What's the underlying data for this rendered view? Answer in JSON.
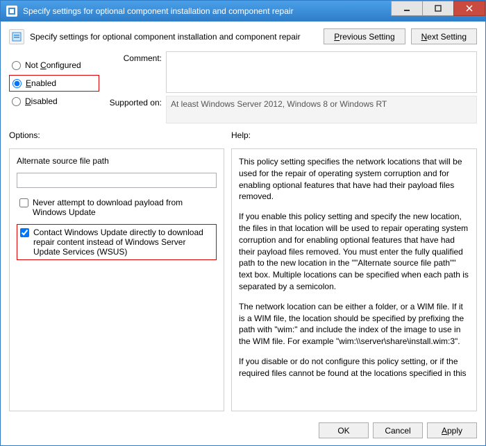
{
  "window": {
    "title": "Specify settings for optional component installation and component repair"
  },
  "header": {
    "text": "Specify settings for optional component installation and component repair",
    "prev_btn": "Previous Setting",
    "next_btn": "Next Setting"
  },
  "radios": {
    "not_configured": "Not Configured",
    "enabled": "Enabled",
    "disabled": "Disabled",
    "selected": "enabled"
  },
  "fields": {
    "comment_label": "Comment:",
    "comment_value": "",
    "supported_label": "Supported on:",
    "supported_value": "At least Windows Server 2012, Windows 8 or Windows RT"
  },
  "labels": {
    "options": "Options:",
    "help": "Help:"
  },
  "options": {
    "alt_path_label": "Alternate source file path",
    "alt_path_value": "",
    "never_download_label": "Never attempt to download payload from Windows Update",
    "never_download_checked": false,
    "contact_wu_label": "Contact Windows Update directly to download repair content instead of Windows Server Update Services (WSUS)",
    "contact_wu_checked": true
  },
  "help": {
    "p1": "This policy setting specifies the network locations that will be used for the repair of operating system corruption and for enabling optional features that have had their payload files removed.",
    "p2": "If you enable this policy setting and specify the new location, the files in that location will be used to repair operating system corruption and for enabling optional features that have had their payload files removed. You must enter the fully qualified path to the new location in the \"\"Alternate source file path\"\" text box. Multiple locations can be specified when each path is separated by a semicolon.",
    "p3": "The network location can be either a folder, or a WIM file. If it is a WIM file, the location should be specified by prefixing the path with \"wim:\" and include the index of the image to use in the WIM file. For example \"wim:\\\\server\\share\\install.wim:3\".",
    "p4": "If you disable or do not configure this policy setting, or if the required files cannot be found at the locations specified in this"
  },
  "buttons": {
    "ok": "OK",
    "cancel": "Cancel",
    "apply": "Apply"
  }
}
